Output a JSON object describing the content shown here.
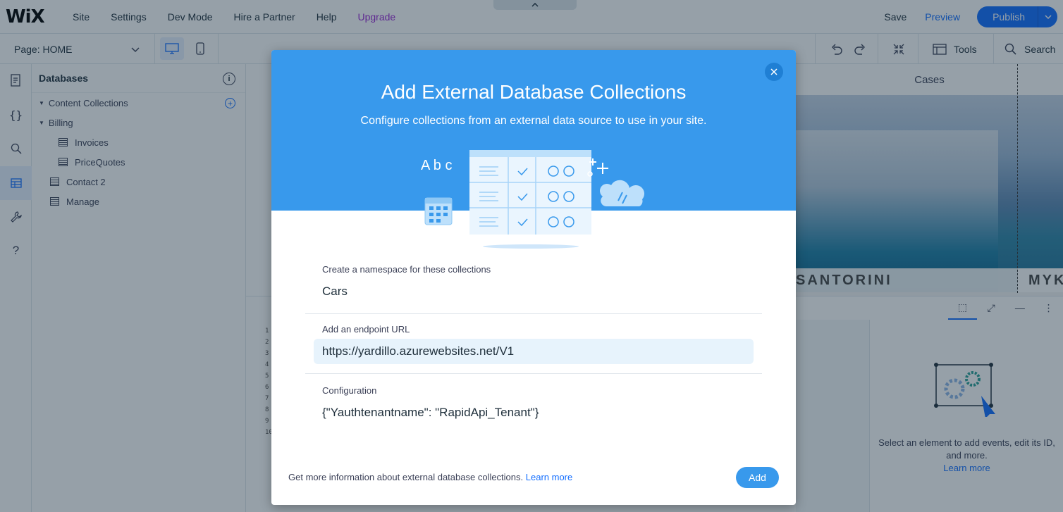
{
  "topbar": {
    "logo": "WiX",
    "menu": [
      "Site",
      "Settings",
      "Dev Mode",
      "Hire a Partner",
      "Help",
      "Upgrade"
    ],
    "save": "Save",
    "preview": "Preview",
    "publish": "Publish"
  },
  "subbar": {
    "page_label": "Page: HOME",
    "tools": "Tools",
    "search": "Search"
  },
  "databases": {
    "title": "Databases",
    "info": "i",
    "items": [
      {
        "label": "Content Collections"
      },
      {
        "label": "Billing"
      },
      {
        "label": "Invoices"
      },
      {
        "label": "PriceQuotes"
      },
      {
        "label": "Contact 2"
      },
      {
        "label": "Manage"
      }
    ]
  },
  "canvas": {
    "cases": "Cases",
    "hero_label_1": "SANTORINI",
    "hero_label_2": "MYK",
    "line_numbers": "1\n2\n3\n4\n5\n6\n7\n8\n9\n10"
  },
  "properties": {
    "message": "Select an element to add events, edit its ID, and more.",
    "learn_more": "Learn more"
  },
  "modal": {
    "title": "Add External Database Collections",
    "subtitle": "Configure collections from an external data source to use in your site.",
    "illus_letters": "A b c",
    "fields": [
      {
        "label": "Create a namespace for these collections",
        "value": "Cars"
      },
      {
        "label": "Add an endpoint URL",
        "value": "https://yardillo.azurewebsites.net/V1"
      },
      {
        "label": "Configuration",
        "value": "{\"Yauthtenantname\": \"RapidApi_Tenant\"}"
      }
    ],
    "footer_text": "Get more information about external database collections.",
    "footer_link": "Learn more",
    "add_button": "Add"
  },
  "colors": {
    "accent": "#116dff",
    "modal_header": "#3899ec",
    "upgrade": "#9a27d5"
  }
}
